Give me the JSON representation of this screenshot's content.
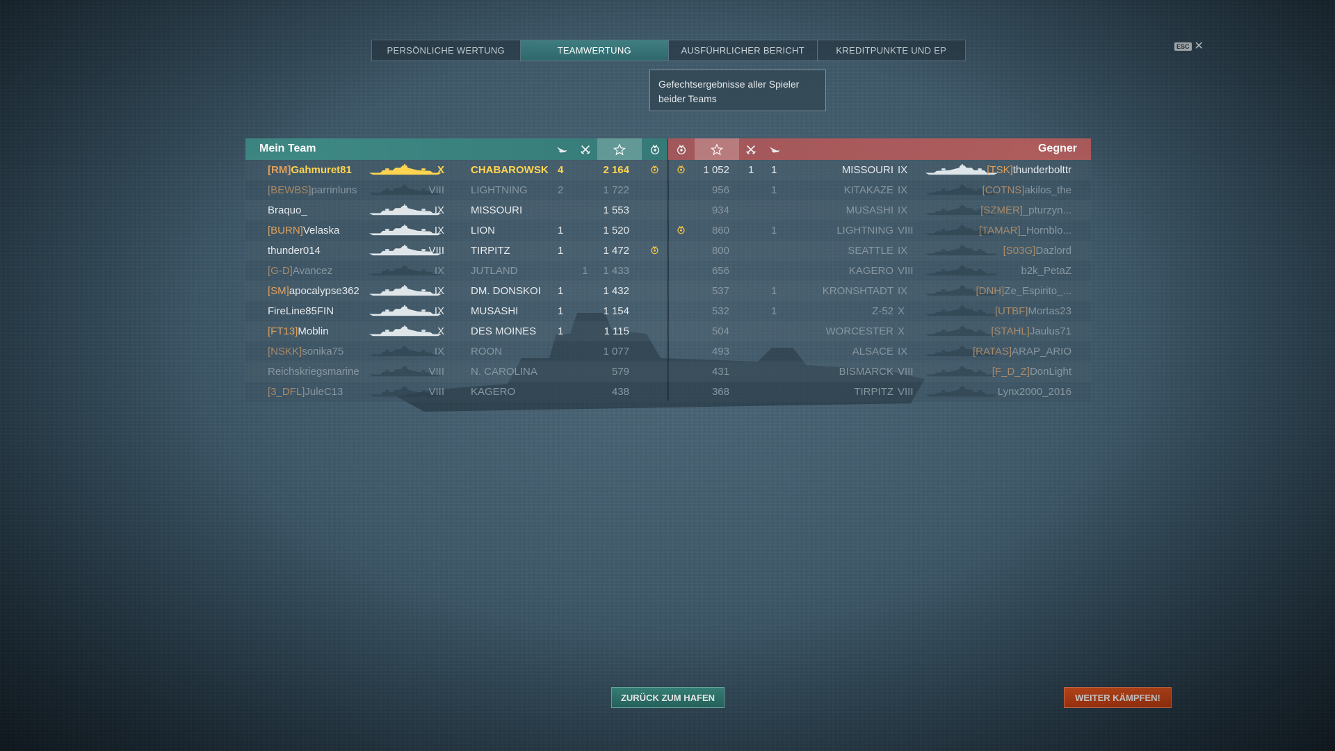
{
  "tabs": [
    {
      "label": "PERSÖNLICHE WERTUNG",
      "active": false
    },
    {
      "label": "TEAMWERTUNG",
      "active": true
    },
    {
      "label": "AUSFÜHRLICHER BERICHT",
      "active": false
    },
    {
      "label": "KREDITPUNKTE UND EP",
      "active": false
    }
  ],
  "tooltip": {
    "line1": "Gefechtsergebnisse aller Spieler",
    "line2": "beider Teams"
  },
  "esc": {
    "badge": "ESC",
    "close": "✕"
  },
  "my_team": {
    "title": "Mein Team",
    "rows": [
      {
        "clan": "[RM]",
        "name": "Gahmuret81",
        "tier": "X",
        "ship": "CHABAROWSK",
        "planes": "",
        "kills": "4",
        "xp": "2 164",
        "medal": true,
        "state": "me"
      },
      {
        "clan": "[BEWBS]",
        "name": "parrinluns",
        "tier": "VIII",
        "ship": "LIGHTNING",
        "planes": "",
        "kills": "2",
        "xp": "1 722",
        "medal": false,
        "state": "dead"
      },
      {
        "clan": "",
        "name": "Braquo_",
        "tier": "IX",
        "ship": "MISSOURI",
        "planes": "",
        "kills": "",
        "xp": "1 553",
        "medal": false,
        "state": "alive"
      },
      {
        "clan": "[BURN]",
        "name": "Velaska",
        "tier": "IX",
        "ship": "LION",
        "planes": "",
        "kills": "1",
        "xp": "1 520",
        "medal": false,
        "state": "alive"
      },
      {
        "clan": "",
        "name": "thunder014",
        "tier": "VIII",
        "ship": "TIRPITZ",
        "planes": "",
        "kills": "1",
        "xp": "1 472",
        "medal": true,
        "state": "alive"
      },
      {
        "clan": "[G-D]",
        "name": "Avancez",
        "tier": "IX",
        "ship": "JUTLAND",
        "planes": "1",
        "kills": "",
        "xp": "1 433",
        "medal": false,
        "state": "dead"
      },
      {
        "clan": "[SM]",
        "name": "apocalypse362",
        "tier": "IX",
        "ship": "DM. DONSKOI",
        "planes": "",
        "kills": "1",
        "xp": "1 432",
        "medal": false,
        "state": "alive"
      },
      {
        "clan": "",
        "name": "FireLine85FIN",
        "tier": "IX",
        "ship": "MUSASHI",
        "planes": "",
        "kills": "1",
        "xp": "1 154",
        "medal": false,
        "state": "alive"
      },
      {
        "clan": "[FT13]",
        "name": "Moblin",
        "tier": "X",
        "ship": "DES MOINES",
        "planes": "",
        "kills": "1",
        "xp": "1 115",
        "medal": false,
        "state": "alive"
      },
      {
        "clan": "[NSKK]",
        "name": "sonika75",
        "tier": "IX",
        "ship": "ROON",
        "planes": "",
        "kills": "",
        "xp": "1 077",
        "medal": false,
        "state": "dead"
      },
      {
        "clan": "",
        "name": "Reichskriegsmarine",
        "tier": "VIII",
        "ship": "N. CAROLINA",
        "planes": "",
        "kills": "",
        "xp": "579",
        "medal": false,
        "state": "dead"
      },
      {
        "clan": "[3_DFL]",
        "name": "JuleC13",
        "tier": "VIII",
        "ship": "KAGERO",
        "planes": "",
        "kills": "",
        "xp": "438",
        "medal": false,
        "state": "dead"
      }
    ]
  },
  "enemy_team": {
    "title": "Gegner",
    "rows": [
      {
        "medal": true,
        "xp": "1 052",
        "kills": "1",
        "planes": "1",
        "ship": "MISSOURI",
        "tier": "IX",
        "clan": "[TSK]",
        "name": "thunderbolttr",
        "state": "alive"
      },
      {
        "medal": false,
        "xp": "956",
        "kills": "",
        "planes": "1",
        "ship": "KITAKAZE",
        "tier": "IX",
        "clan": "[COTNS]",
        "name": "akilos_the",
        "state": "dead"
      },
      {
        "medal": false,
        "xp": "934",
        "kills": "",
        "planes": "",
        "ship": "MUSASHI",
        "tier": "IX",
        "clan": "[SZMER]",
        "name": "_pturzyn...",
        "state": "dead"
      },
      {
        "medal": true,
        "xp": "860",
        "kills": "",
        "planes": "1",
        "ship": "LIGHTNING",
        "tier": "VIII",
        "clan": "[TAMAR]",
        "name": "_Hornblo...",
        "state": "dead"
      },
      {
        "medal": false,
        "xp": "800",
        "kills": "",
        "planes": "",
        "ship": "SEATTLE",
        "tier": "IX",
        "clan": "[S03G]",
        "name": "Dazlord",
        "state": "dead"
      },
      {
        "medal": false,
        "xp": "656",
        "kills": "",
        "planes": "",
        "ship": "KAGERO",
        "tier": "VIII",
        "clan": "",
        "name": "b2k_PetaZ",
        "state": "dead"
      },
      {
        "medal": false,
        "xp": "537",
        "kills": "",
        "planes": "1",
        "ship": "KRONSHTADT",
        "tier": "IX",
        "clan": "[DNH]",
        "name": "Ze_Espirito_...",
        "state": "dead"
      },
      {
        "medal": false,
        "xp": "532",
        "kills": "",
        "planes": "1",
        "ship": "Z-52",
        "tier": "X",
        "clan": "[UTBF]",
        "name": "Mortas23",
        "state": "dead"
      },
      {
        "medal": false,
        "xp": "504",
        "kills": "",
        "planes": "",
        "ship": "WORCESTER",
        "tier": "X",
        "clan": "[STAHL]",
        "name": "Jaulus71",
        "state": "dead"
      },
      {
        "medal": false,
        "xp": "493",
        "kills": "",
        "planes": "",
        "ship": "ALSACE",
        "tier": "IX",
        "clan": "[RATAS]",
        "name": "ARAP_ARIO",
        "state": "dead"
      },
      {
        "medal": false,
        "xp": "431",
        "kills": "",
        "planes": "",
        "ship": "BISMARCK",
        "tier": "VIII",
        "clan": "[F_D_Z]",
        "name": "DonLight",
        "state": "dead"
      },
      {
        "medal": false,
        "xp": "368",
        "kills": "",
        "planes": "",
        "ship": "TIRPITZ",
        "tier": "VIII",
        "clan": "",
        "name": "Lynx2000_2016",
        "state": "dead"
      }
    ]
  },
  "buttons": {
    "harbor": "ZURÜCK ZUM HAFEN",
    "fight": "WEITER KÄMPFEN!"
  },
  "icons": {
    "planes": "aircraft-icon",
    "kills": "crossed-swords-icon",
    "xp": "star-icon",
    "medal": "medal-icon"
  },
  "colors": {
    "my_team_header": "#3f8a86",
    "enemy_header": "#b05d5d",
    "clan": "#e0a15d",
    "self": "#ffd54f",
    "fight_button": "#d84a18",
    "harbor_button": "#2f7a72"
  }
}
